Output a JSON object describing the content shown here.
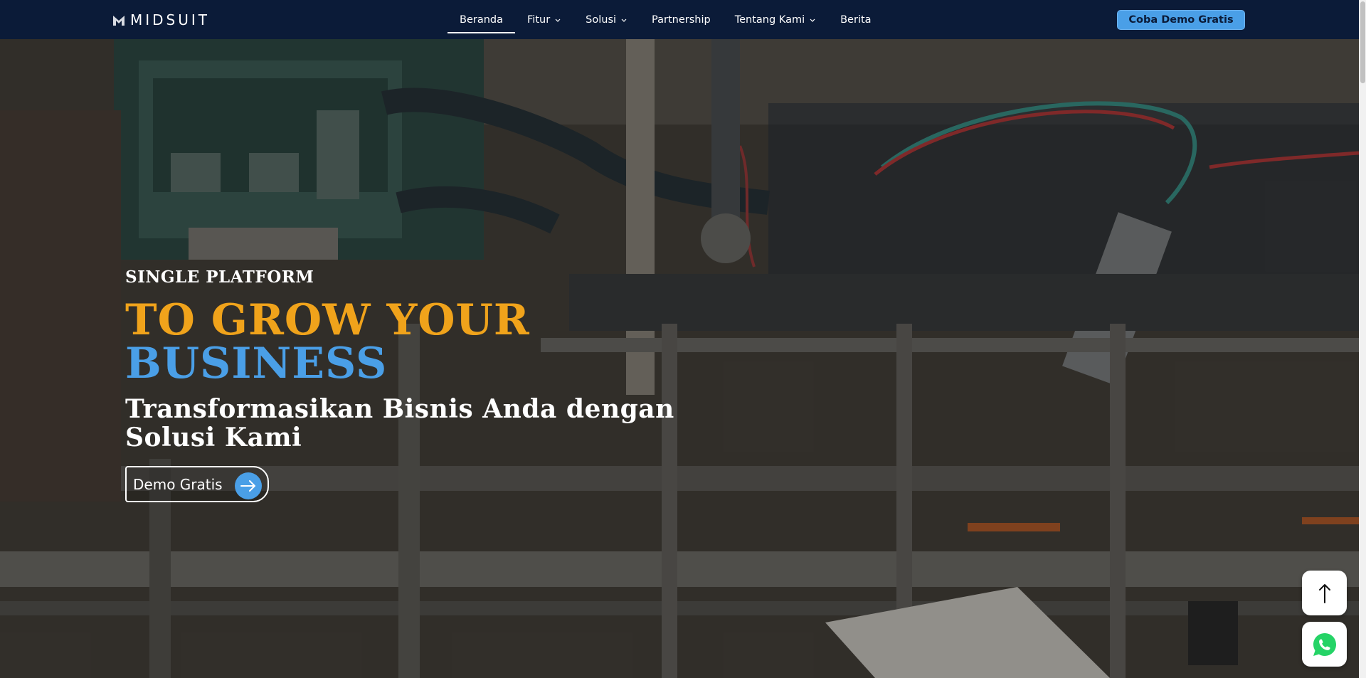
{
  "header": {
    "logo_text": "MIDSUIT",
    "nav": [
      {
        "label": "Beranda",
        "active": true,
        "dropdown": false
      },
      {
        "label": "Fitur",
        "active": false,
        "dropdown": true
      },
      {
        "label": "Solusi",
        "active": false,
        "dropdown": true
      },
      {
        "label": "Partnership",
        "active": false,
        "dropdown": false
      },
      {
        "label": "Tentang Kami",
        "active": false,
        "dropdown": true
      },
      {
        "label": "Berita",
        "active": false,
        "dropdown": false
      }
    ],
    "cta_label": "Coba Demo Gratis"
  },
  "hero": {
    "eyebrow": "SINGLE PLATFORM",
    "title_line1": "TO GROW YOUR",
    "title_line2": "BUSINESS",
    "subtitle": "Transformasikan Bisnis Anda dengan Solusi Kami",
    "demo_button_label": "Demo Gratis"
  },
  "floating": {
    "scroll_top_icon": "arrow-up-icon",
    "whatsapp_icon": "whatsapp-icon"
  },
  "colors": {
    "nav_bg": "#0b1b38",
    "accent_blue": "#4a9fe7",
    "accent_orange": "#f0a31b",
    "whatsapp_green": "#25d366"
  }
}
